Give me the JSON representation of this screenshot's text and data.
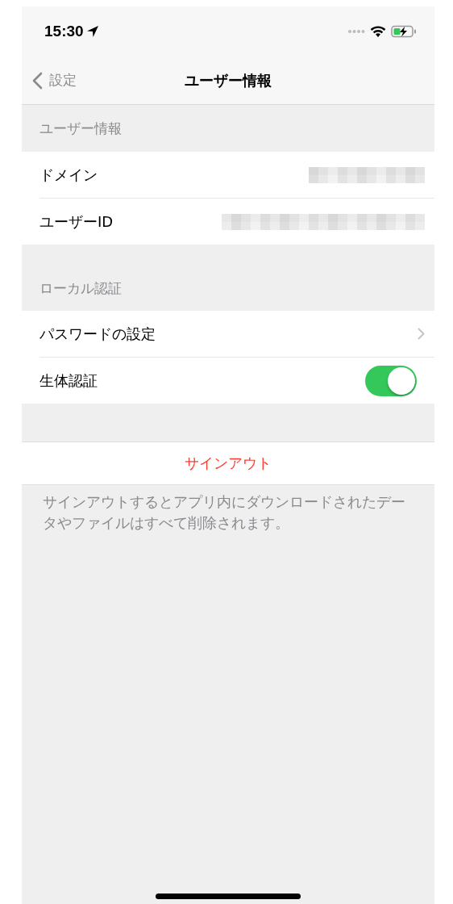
{
  "status_bar": {
    "time": "15:30"
  },
  "nav": {
    "back": "設定",
    "title": "ユーザー情報"
  },
  "sections": [
    {
      "header": "ユーザー情報",
      "rows": [
        {
          "kind": "redacted",
          "label": "ドメイン"
        },
        {
          "kind": "obscured",
          "label": "ユーザーID"
        }
      ]
    },
    {
      "header": "ローカル認証",
      "rows": [
        {
          "kind": "link",
          "label": "パスワードの設定"
        },
        {
          "kind": "toggle",
          "label": "生体認証",
          "on": true
        }
      ]
    }
  ],
  "sign_out": {
    "label": "サインアウト",
    "note": "サインアウトするとアプリ内にダウンロードされたデータやファイルはすべて削除されます。"
  }
}
